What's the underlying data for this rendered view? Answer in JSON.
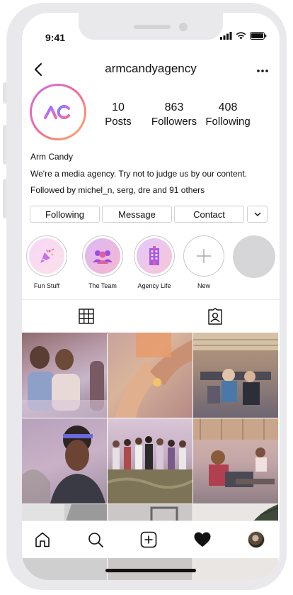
{
  "status_bar": {
    "time": "9:41"
  },
  "header": {
    "username": "armcandyagency",
    "more_label": "•••"
  },
  "profile": {
    "avatar_text": "AC",
    "stats": [
      {
        "value": "10",
        "label": "Posts"
      },
      {
        "value": "863",
        "label": "Followers"
      },
      {
        "value": "408",
        "label": "Following"
      }
    ],
    "name": "Arm Candy",
    "bio": "We're a media agency. Try not to judge us by our content.",
    "followed_by": "Followed by michel_n, serg, dre and 91 others"
  },
  "buttons": {
    "following": "Following",
    "message": "Message",
    "contact": "Contact"
  },
  "highlights": [
    {
      "label": "Fun Stuff",
      "icon": "party-popper-icon"
    },
    {
      "label": "The Team",
      "icon": "group-icon"
    },
    {
      "label": "Agency Life",
      "icon": "building-icon"
    },
    {
      "label": "New",
      "icon": "plus-icon"
    }
  ],
  "tabs": [
    {
      "name": "grid",
      "icon": "grid-icon",
      "active": true
    },
    {
      "name": "tagged",
      "icon": "tagged-user-icon",
      "active": false
    }
  ],
  "bottom_nav": [
    "home-icon",
    "search-icon",
    "add-post-icon",
    "heart-icon",
    "profile-avatar"
  ],
  "colors": {
    "accent_purple": "#b66cf0",
    "accent_pink": "#f36b8f",
    "accent_orange": "#f9b267"
  }
}
